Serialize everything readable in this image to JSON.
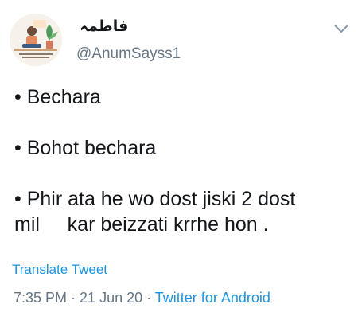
{
  "user": {
    "display_name": "فاطمہ",
    "handle": "@AnumSayss1"
  },
  "tweet": {
    "lines": [
      "• Bechara",
      "• Bohot bechara",
      "• Phir ata he wo dost jiski 2 dost",
      "mil     kar beizzati krrhe hon ."
    ]
  },
  "actions": {
    "translate_label": "Translate Tweet",
    "menu_icon": "chevron-down-icon"
  },
  "meta": {
    "time": "7:35 PM",
    "sep1": " · ",
    "date": "21 Jun 20",
    "sep2": " · ",
    "source": "Twitter for Android"
  }
}
